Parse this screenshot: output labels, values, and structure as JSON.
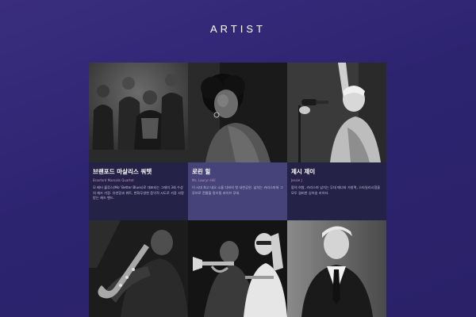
{
  "page": {
    "title": "ARTIST"
  },
  "artists": [
    {
      "name": "브랜포드 마살리스 쿼텟",
      "subtitle": "Branford Marsalis Quartet",
      "description": "모 베터 블루스(Mo' Better Blues)로 대표되는 그래미 3회 수상의 재즈 거장. 유연함과 위트, 변화무쌍한 음악적 시도로 가장 사랑받는 재즈 밴드.",
      "accent": "#252247"
    },
    {
      "name": "로린 힐",
      "subtitle": "Ms. Lauryn Hill",
      "description": "이 시대 최고 네오 소울 디바의 첫 내한공연. 넘치는 카리스마와 그루브로 전율을 맛으킬 라이브 무대.",
      "accent": "#46437a"
    },
    {
      "name": "제시 제이",
      "subtitle": "Jessie J",
      "description": "팝의 여왕, 카리스마 넘치는 무대 매너와 가창력, 스타일리시함을 모두 겸비한 싱어송 라이터.",
      "accent": "#252247"
    },
    {
      "name": "",
      "subtitle": "",
      "description": ""
    },
    {
      "name": "",
      "subtitle": "",
      "description": ""
    },
    {
      "name": "",
      "subtitle": "",
      "description": ""
    }
  ]
}
